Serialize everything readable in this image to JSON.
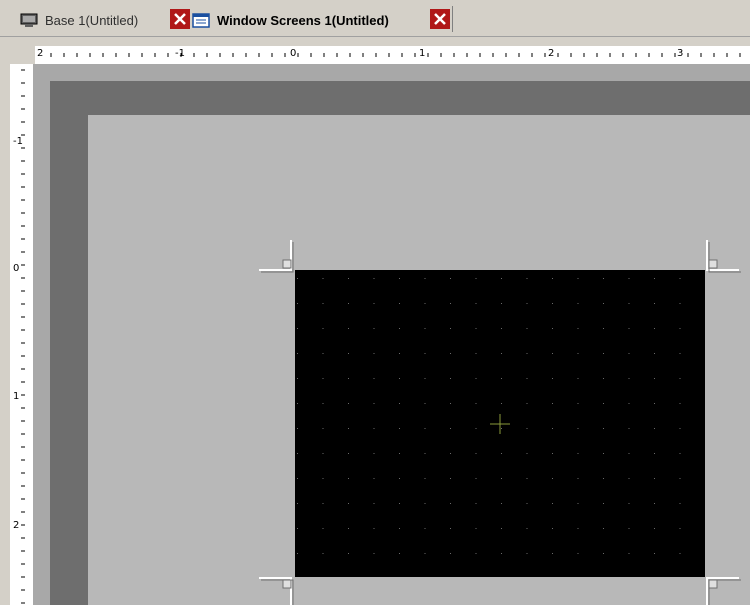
{
  "tabs": [
    {
      "label": "Base 1(Untitled)",
      "icon": "base-screen-icon",
      "active": false
    },
    {
      "label": "Window Screens 1(Untitled)",
      "icon": "window-screen-icon",
      "active": true
    }
  ],
  "horizontal_ruler": {
    "labels": [
      "2",
      "-1",
      "0",
      "1",
      "2",
      "3"
    ]
  },
  "vertical_ruler": {
    "labels": [
      "-1",
      "0",
      "1",
      "2"
    ]
  },
  "colors": {
    "background": "#a8a8a8",
    "frame": "#6e6e6e",
    "screen": "#000000",
    "close_button": "#b01818"
  }
}
